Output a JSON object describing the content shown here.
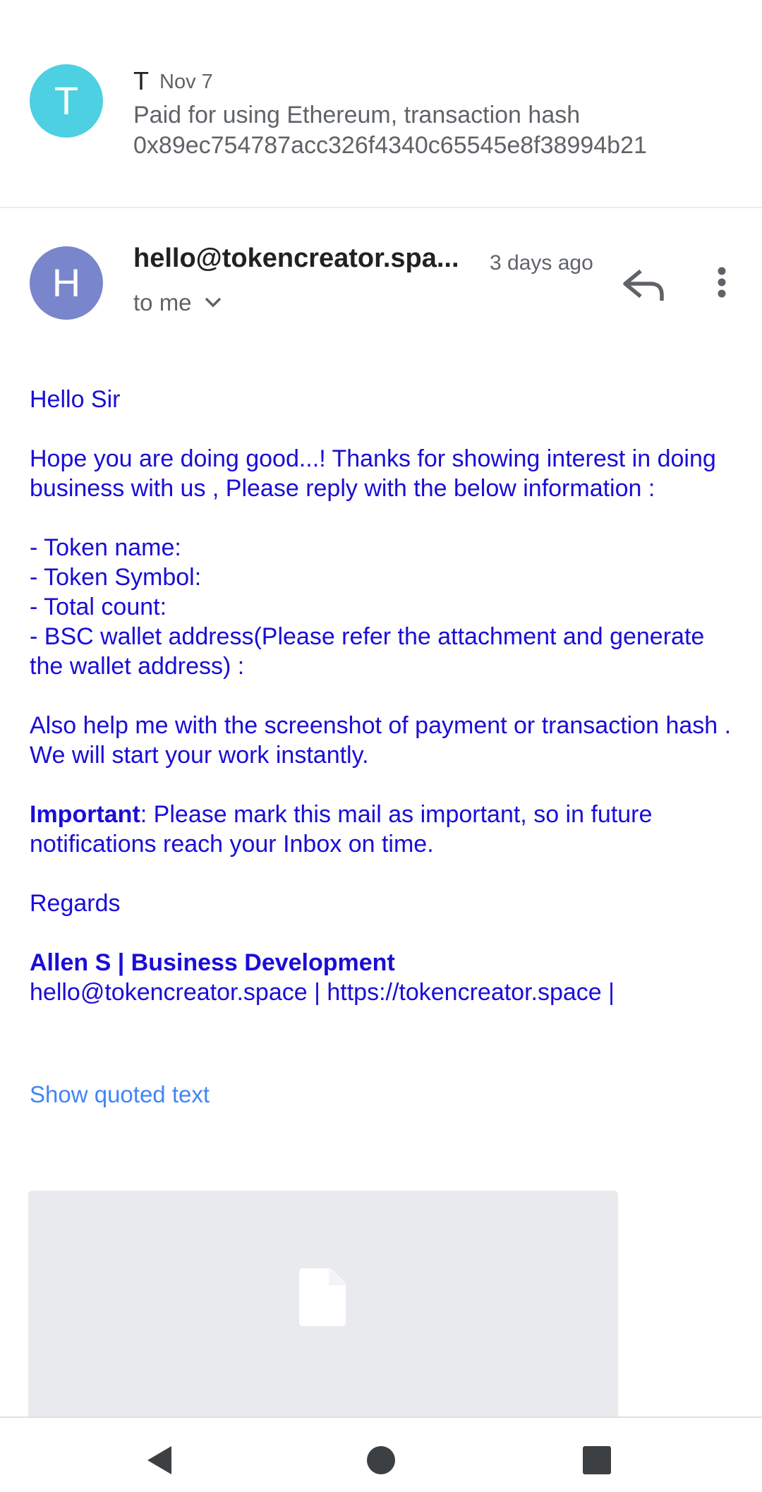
{
  "collapsed_message": {
    "avatar_letter": "T",
    "sender": "T",
    "date": "Nov 7",
    "snippet": "Paid for using Ethereum, transaction hash 0x89ec754787acc326f4340c65545e8f38994b21"
  },
  "expanded_message": {
    "avatar_letter": "H",
    "sender": "hello@tokencreator.spa...",
    "date": "3 days ago",
    "recipient": "to me",
    "body": {
      "greeting": "Hello Sir",
      "intro": "Hope you are doing good...! Thanks for showing interest in doing business with us , Please reply with the below information :",
      "items": [
        "- Token name:",
        "- Token Symbol:",
        "- Total count:",
        "- BSC wallet address(Please refer the attachment and generate the wallet address) :"
      ],
      "request": "Also help me with the screenshot of payment or transaction hash . We will start your work instantly.",
      "important_label": "Important",
      "important_text": ": Please mark this mail as important, so in future notifications reach your Inbox on time.",
      "closing": "Regards",
      "signature_name": "Allen S | Business Development",
      "signature_contact": "hello@tokencreator.space | https://tokencreator.space |"
    },
    "show_quoted_text": "Show quoted text"
  },
  "icons": {
    "reply": "reply-icon",
    "more": "more-vert-icon",
    "expand": "chevron-down-icon",
    "attachment": "file-icon"
  },
  "colors": {
    "avatar_t": "#4dd0e1",
    "avatar_h": "#7986cb",
    "body_text": "#1a0dd6",
    "link": "#4285f4"
  }
}
